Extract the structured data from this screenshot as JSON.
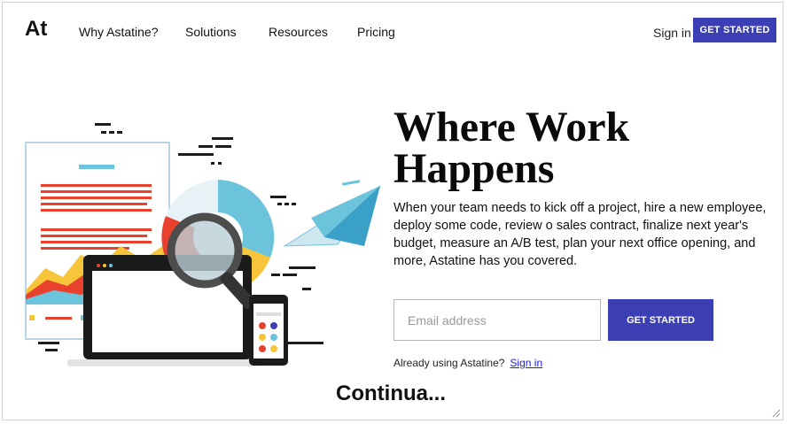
{
  "brand": {
    "logo": "At"
  },
  "nav": {
    "items": [
      "Why Astatine?",
      "Solutions",
      "Resources",
      "Pricing"
    ]
  },
  "header": {
    "sign_in": "Sign in",
    "cta": "GET STARTED"
  },
  "hero": {
    "headline_line1": "Where Work",
    "headline_line2": "Happens",
    "description": "When your team needs to kick off a project, hire a new employee, deploy some code, review o sales contract, finalize next year's budget, measure an A/B test, plan your next office opening, and more, Astatine has you covered.",
    "email_placeholder": "Email address",
    "cta": "GET STARTED",
    "already_text": "Already using Astatine?",
    "sign_in_link": "Sign in"
  },
  "footer": {
    "continua": "Continua..."
  },
  "colors": {
    "accent": "#3b3fb3",
    "link": "#1a1aee",
    "illustration_blue": "#6cc4dc",
    "illustration_red": "#e8422e",
    "illustration_yellow": "#f7c53a"
  },
  "icons": [
    "magnifier-icon",
    "paper-plane-icon",
    "laptop-icon",
    "phone-icon",
    "resize-grip-icon"
  ]
}
